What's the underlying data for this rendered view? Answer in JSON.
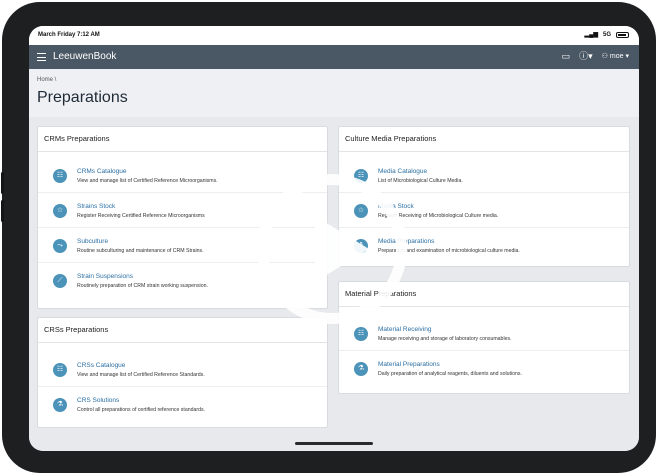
{
  "status_bar": {
    "time": "March Friday 7:12 AM",
    "signal": "5G"
  },
  "app_bar": {
    "app_name": "LeeuwenBook",
    "user": "moe"
  },
  "breadcrumb": "Home",
  "page_title": "Preparations",
  "cards": {
    "crms": {
      "title": "CRMs Preparations",
      "items": [
        {
          "title": "CRMs Catalogue",
          "desc": "View and manage list of Certified Reference Microorganisms.",
          "icon": "list-icon"
        },
        {
          "title": "Strains Stock",
          "desc": "Register Receiving Certified Reference Microorganisms",
          "icon": "star-icon"
        },
        {
          "title": "Subculture",
          "desc": "Routine subculturing and maintenance of CRM Strains.",
          "icon": "subculture-icon"
        },
        {
          "title": "Strain Suspensions",
          "desc": "Routinely preparation of CRM strain working suspension.",
          "icon": "pipette-icon"
        }
      ]
    },
    "crss": {
      "title": "CRSs Preparations",
      "items": [
        {
          "title": "CRSs Catalogue",
          "desc": "View and manage list of Certified Reference Standards.",
          "icon": "list-icon"
        },
        {
          "title": "CRS Solutions",
          "desc": "Control all preparations of certified reference standards.",
          "icon": "flask-icon"
        }
      ]
    },
    "culture": {
      "title": "Culture Media Preparations",
      "items": [
        {
          "title": "Media Catalogue",
          "desc": "List of Microbiological Culture Media.",
          "icon": "list-icon"
        },
        {
          "title": "Media Stock",
          "desc": "Register Receiving of Microbiological Culture media.",
          "icon": "star-icon"
        },
        {
          "title": "Media Preparations",
          "desc": "Preparation and examination of microbiological culture media.",
          "icon": "beaker-icon"
        }
      ]
    },
    "material": {
      "title": "Material Preparations",
      "items": [
        {
          "title": "Material Receiving",
          "desc": "Manage receiving and storage of laboratory consumables.",
          "icon": "list-icon"
        },
        {
          "title": "Material Preparations",
          "desc": "Daily preparation of analytical reagents, diluents and solutions.",
          "icon": "flask-icon"
        }
      ]
    }
  }
}
